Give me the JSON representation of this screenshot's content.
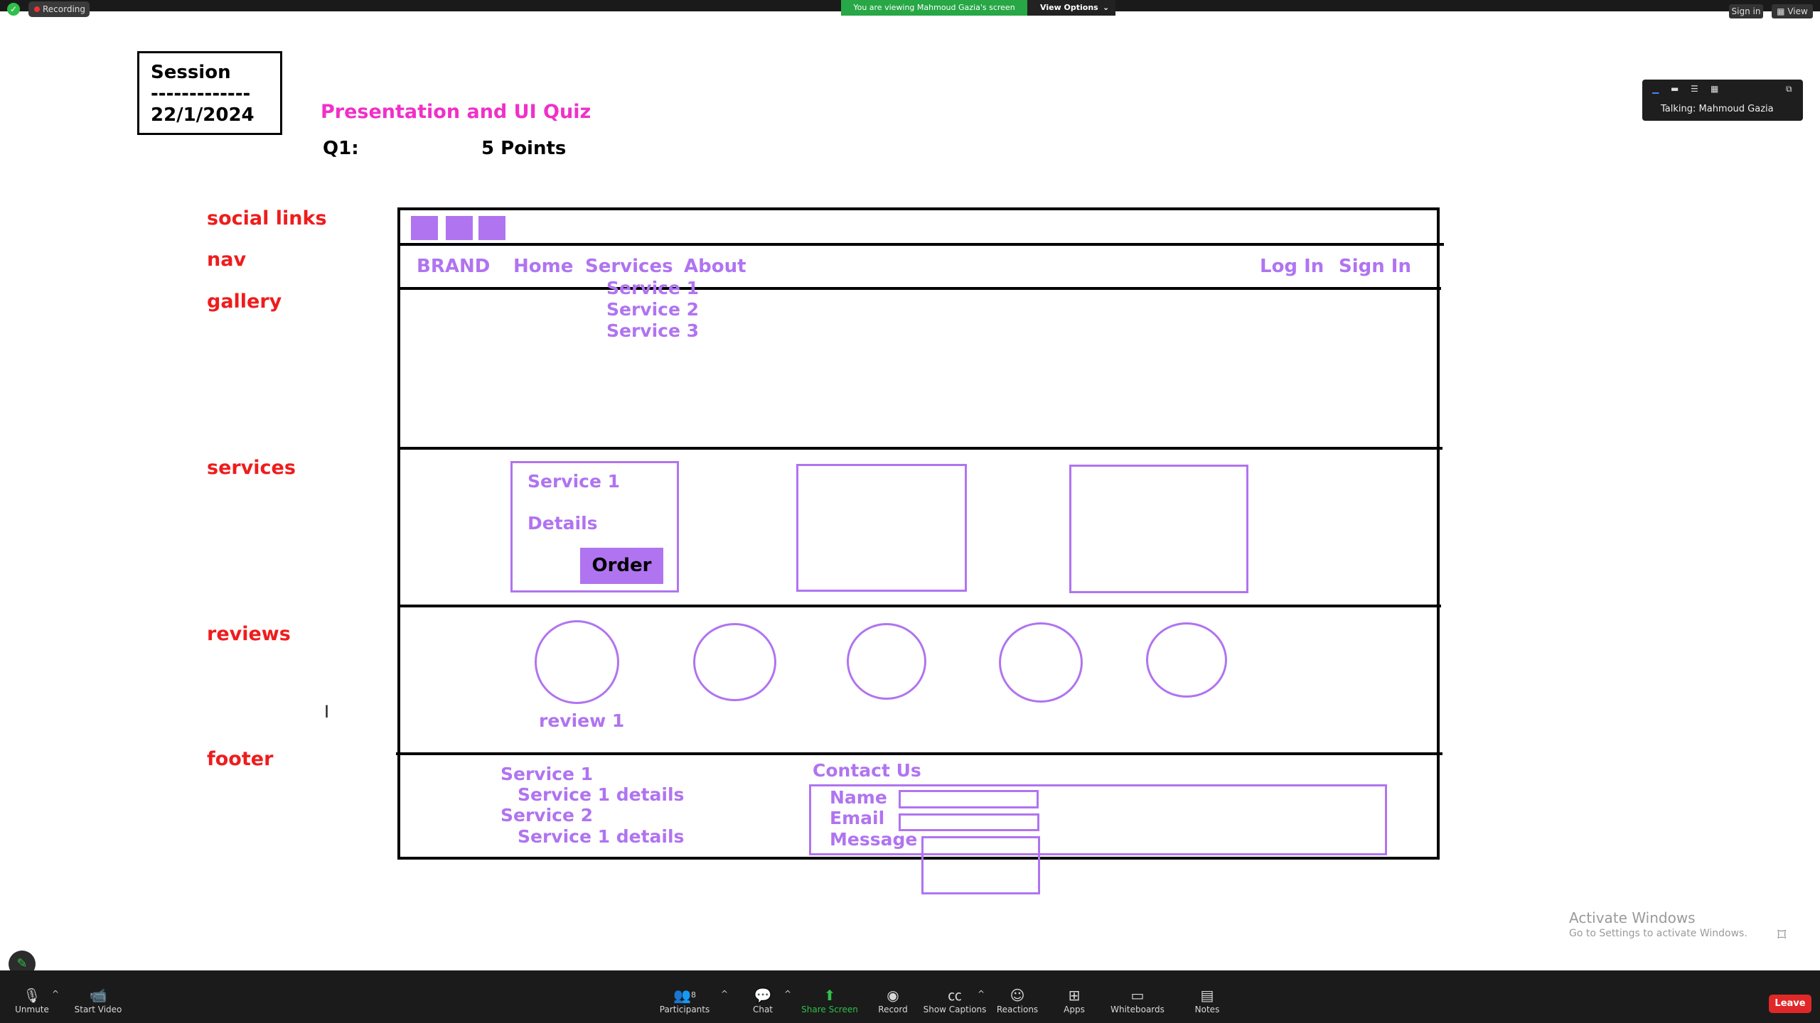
{
  "topbar": {
    "recording_label": "Recording",
    "viewing_banner": "You are viewing Mahmoud Gazia's screen",
    "view_options": "View Options",
    "sign_in": "Sign in",
    "view": "View"
  },
  "whiteboard": {
    "session_title": "Session",
    "session_divider": "-------------",
    "session_date": "22/1/2024",
    "quiz_title": "Presentation and UI Quiz",
    "question_label": "Q1:",
    "points": "5 Points",
    "side_labels": {
      "social_links": "social links",
      "nav": "nav",
      "gallery": "gallery",
      "services": "services",
      "reviews": "reviews",
      "footer": "footer"
    },
    "nav": {
      "brand": "BRAND",
      "home": "Home",
      "services": "Services",
      "about": "About",
      "login": "Log In",
      "signin": "Sign In",
      "dropdown": [
        "Service 1",
        "Service 2",
        "Service 3"
      ]
    },
    "service_card": {
      "title": "Service 1",
      "details": "Details",
      "order": "Order"
    },
    "review_label": "review 1",
    "footer": {
      "service1": "Service 1",
      "service1_details": "Service 1 details",
      "service2": "Service 2",
      "service2_details": "Service 1 details",
      "contact_title": "Contact Us",
      "name_label": "Name",
      "email_label": "Email",
      "message_label": "Message"
    },
    "colors": {
      "purple": "#b074f0",
      "red": "#ef1c1c",
      "pink": "#f030c8"
    }
  },
  "talking_panel": {
    "text": "Talking: Mahmoud Gazia"
  },
  "activate_windows": {
    "title": "Activate Windows",
    "subtitle": "Go to Settings to activate Windows."
  },
  "toolbar": {
    "unmute": "Unmute",
    "start_video": "Start Video",
    "participants": "Participants",
    "participants_count": "8",
    "chat": "Chat",
    "share_screen": "Share Screen",
    "record": "Record",
    "show_captions": "Show Captions",
    "reactions": "Reactions",
    "apps": "Apps",
    "whiteboards": "Whiteboards",
    "notes": "Notes",
    "leave": "Leave"
  }
}
